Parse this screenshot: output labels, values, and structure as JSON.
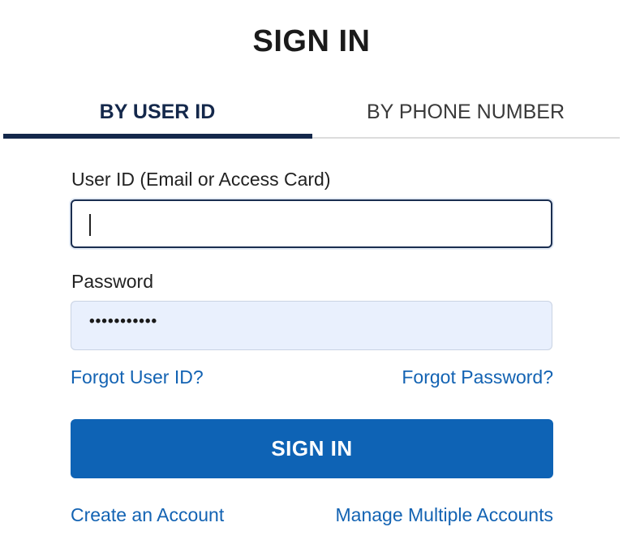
{
  "header": {
    "title": "SIGN IN"
  },
  "tabs": [
    {
      "label": "BY USER ID",
      "active": true
    },
    {
      "label": "BY PHONE NUMBER",
      "active": false
    }
  ],
  "form": {
    "user_id": {
      "label": "User ID (Email or Access Card)",
      "value": ""
    },
    "password": {
      "label": "Password",
      "value": "•••••••••••"
    }
  },
  "links": {
    "forgot_user_id": "Forgot User ID?",
    "forgot_password": "Forgot Password?",
    "create_account": "Create an Account",
    "manage_accounts": "Manage Multiple Accounts"
  },
  "buttons": {
    "sign_in": "SIGN IN"
  },
  "colors": {
    "primary": "#0e63b5",
    "link": "#1363b3",
    "tab_active": "#14284b",
    "password_field_bg": "#e9f0fd"
  }
}
